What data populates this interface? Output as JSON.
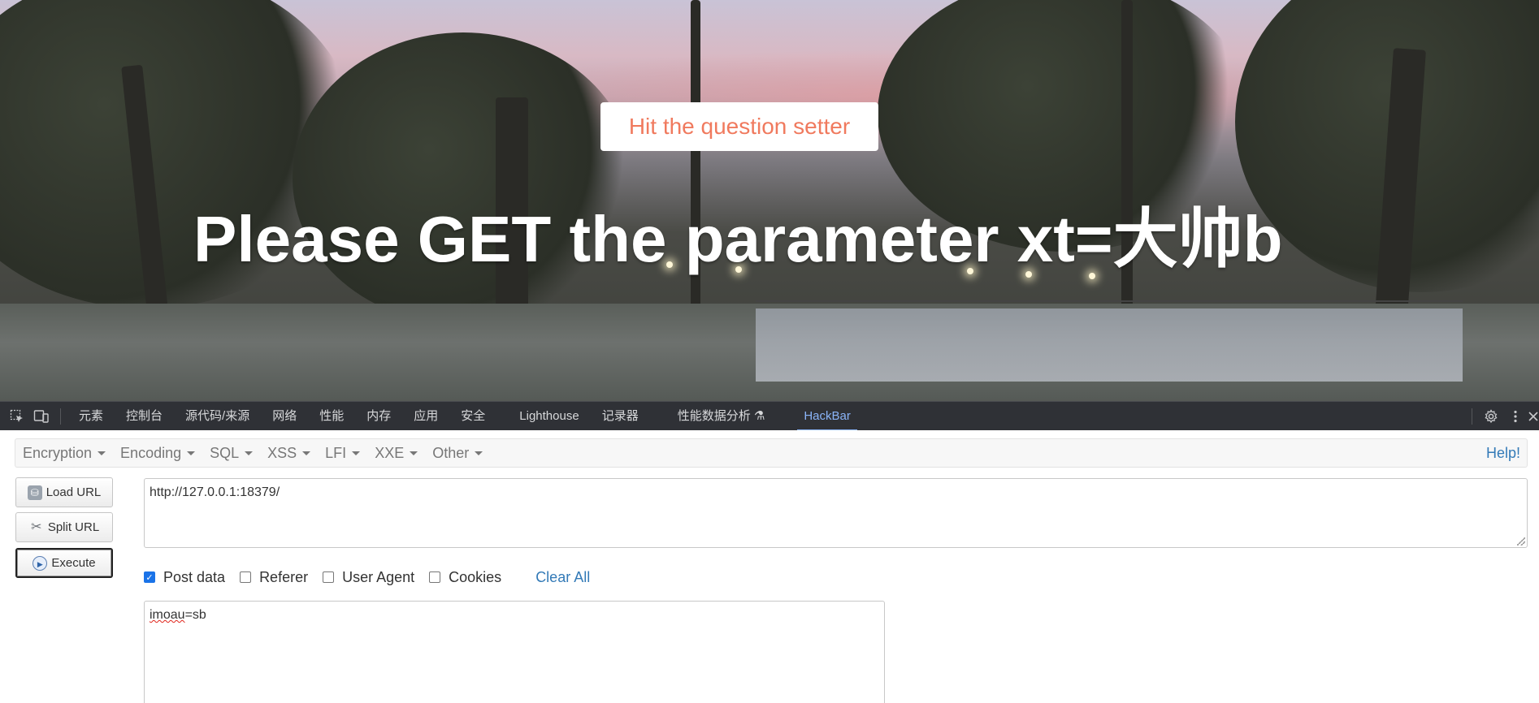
{
  "page": {
    "hit_button": "Hit the question setter",
    "headline": "Please GET the parameter xt=大帅b"
  },
  "devtools": {
    "tabs": [
      {
        "label": "元素"
      },
      {
        "label": "控制台"
      },
      {
        "label": "源代码/来源"
      },
      {
        "label": "网络"
      },
      {
        "label": "性能"
      },
      {
        "label": "内存"
      },
      {
        "label": "应用"
      },
      {
        "label": "安全"
      },
      {
        "label": "Lighthouse"
      },
      {
        "label": "记录器"
      },
      {
        "label": "性能数据分析 ⚗"
      },
      {
        "label": "HackBar"
      }
    ],
    "active_tab": "HackBar",
    "icons": [
      "inspect-element-icon",
      "device-toolbar-icon",
      "gear-icon",
      "more-vertical-icon",
      "close-icon"
    ]
  },
  "hackbar": {
    "menu": [
      {
        "label": "Encryption"
      },
      {
        "label": "Encoding"
      },
      {
        "label": "SQL"
      },
      {
        "label": "XSS"
      },
      {
        "label": "LFI"
      },
      {
        "label": "XXE"
      },
      {
        "label": "Other"
      }
    ],
    "help": "Help!",
    "buttons": {
      "load_url": "Load URL",
      "split_url": "Split URL",
      "execute": "Execute"
    },
    "url": "http://127.0.0.1:18379/",
    "options": {
      "post_data": {
        "label": "Post data",
        "checked": true
      },
      "referer": {
        "label": "Referer",
        "checked": false
      },
      "user_agent": {
        "label": "User Agent",
        "checked": false
      },
      "cookies": {
        "label": "Cookies",
        "checked": false
      }
    },
    "clear_all": "Clear All",
    "post_body_word": "imoau",
    "post_body_rest": "=sb"
  },
  "colors": {
    "hit_button_text": "#f07a5e",
    "devtools_bg": "#2f3136",
    "active_tab": "#8ab4f8",
    "link": "#337ab7",
    "checkbox_checked": "#1a73e8"
  }
}
